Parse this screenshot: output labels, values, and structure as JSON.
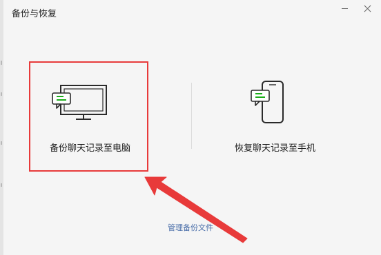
{
  "window": {
    "title": "备份与恢复"
  },
  "options": {
    "backup_label": "备份聊天记录至电脑",
    "restore_label": "恢复聊天记录至手机"
  },
  "footer": {
    "manage_label": "管理备份文件"
  },
  "colors": {
    "accent": "#1aad19",
    "highlight": "#e83a3a",
    "link": "#4a6ea9"
  },
  "icons": {
    "computer": "computer-with-chat-icon",
    "phone": "phone-with-chat-icon"
  }
}
